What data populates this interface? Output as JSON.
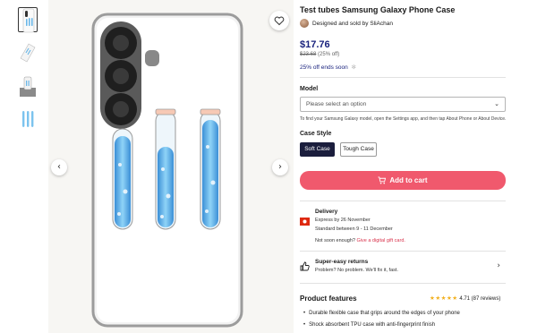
{
  "product": {
    "title": "Test tubes Samsung Galaxy Phone Case",
    "seller_text": "Designed and sold by SliAchan",
    "price": "$17.76",
    "original_price": "$23.68",
    "discount": "(25% off)",
    "sale_text": "25% off ends soon"
  },
  "model": {
    "label": "Model",
    "placeholder": "Please select an option",
    "hint": "To find your Samsung Galaxy model, open the Settings app, and then tap About Phone or About Device."
  },
  "case_style": {
    "label": "Case Style",
    "options": [
      "Soft Case",
      "Tough Case"
    ],
    "selected": "Soft Case"
  },
  "cart": {
    "label": "Add to cart"
  },
  "delivery": {
    "title": "Delivery",
    "express": "Express by 26 November",
    "standard": "Standard between 9 - 11 December",
    "not_soon": "Not soon enough?",
    "gift_link": "Give a digital gift card."
  },
  "returns": {
    "title": "Super-easy returns",
    "subtitle": "Problem? No problem. We'll fix it, fast."
  },
  "features": {
    "title": "Product features",
    "rating": "4.71",
    "reviews": "(87 reviews)",
    "stars": "★★★★★",
    "items": [
      "Durable flexible case that grips around the edges of your phone",
      "Shock absorbent TPU case with anti-fingerprint finish"
    ]
  },
  "gallery": {
    "prev_icon": "‹",
    "next_icon": "›"
  },
  "colors": {
    "price": "#1a237e",
    "cart_button": "#f0596d",
    "selected_style": "#1b1e3d",
    "link": "#d9344d",
    "stars": "#f2b01e"
  },
  "icons": [
    "heart-icon",
    "chevron-left-icon",
    "chevron-right-icon",
    "chevron-down-icon",
    "cart-icon",
    "flag-icon",
    "thumbs-up-icon"
  ]
}
